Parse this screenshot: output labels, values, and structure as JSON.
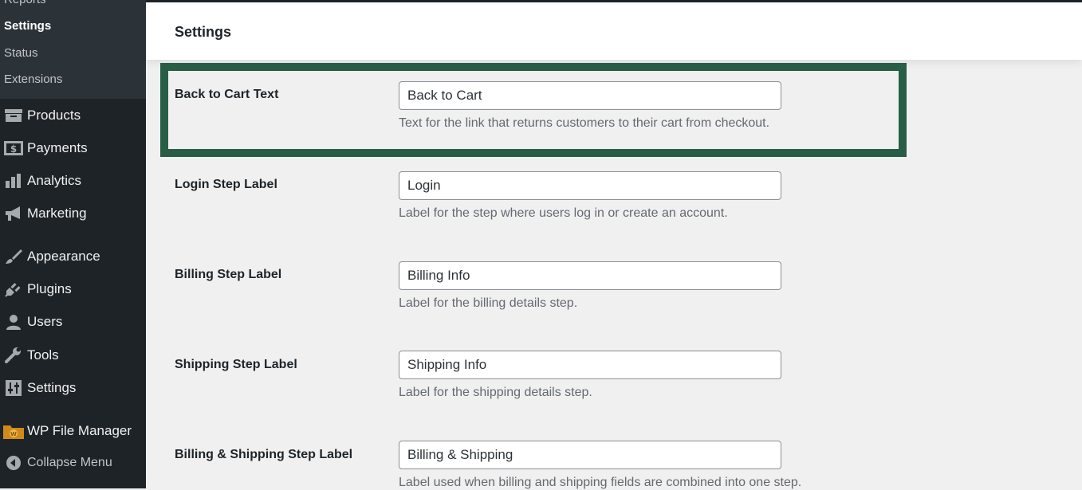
{
  "sidebar": {
    "submenu": {
      "partial_top": "Reports",
      "items": [
        {
          "label": "Settings",
          "current": true
        },
        {
          "label": "Status"
        },
        {
          "label": "Extensions"
        }
      ]
    },
    "menu": [
      {
        "label": "Products",
        "icon": "archive-icon"
      },
      {
        "label": "Payments",
        "icon": "payments-icon"
      },
      {
        "label": "Analytics",
        "icon": "bar-chart-icon"
      },
      {
        "label": "Marketing",
        "icon": "megaphone-icon"
      },
      {
        "label": "Appearance",
        "icon": "paintbrush-icon"
      },
      {
        "label": "Plugins",
        "icon": "plugin-icon"
      },
      {
        "label": "Users",
        "icon": "user-icon"
      },
      {
        "label": "Tools",
        "icon": "wrench-icon"
      },
      {
        "label": "Settings",
        "icon": "sliders-icon"
      },
      {
        "label": "WP File Manager",
        "icon": "file-manager-icon"
      }
    ],
    "collapse_label": "Collapse Menu"
  },
  "header": {
    "title": "Settings"
  },
  "settings": [
    {
      "label": "Back to Cart Text",
      "value": "Back to Cart",
      "description": "Text for the link that returns customers to their cart from checkout."
    },
    {
      "label": "Login Step Label",
      "value": "Login",
      "description": "Label for the step where users log in or create an account."
    },
    {
      "label": "Billing Step Label",
      "value": "Billing Info",
      "description": "Label for the billing details step."
    },
    {
      "label": "Shipping Step Label",
      "value": "Shipping Info",
      "description": "Label for the shipping details step."
    },
    {
      "label": "Billing & Shipping Step Label",
      "value": "Billing & Shipping",
      "description": "Label used when billing and shipping fields are combined into one step."
    }
  ],
  "colors": {
    "sidebar_bg": "#1d2327",
    "submenu_bg": "#2c3338",
    "highlight_border": "#285e45",
    "page_bg": "#f0f0f1"
  }
}
